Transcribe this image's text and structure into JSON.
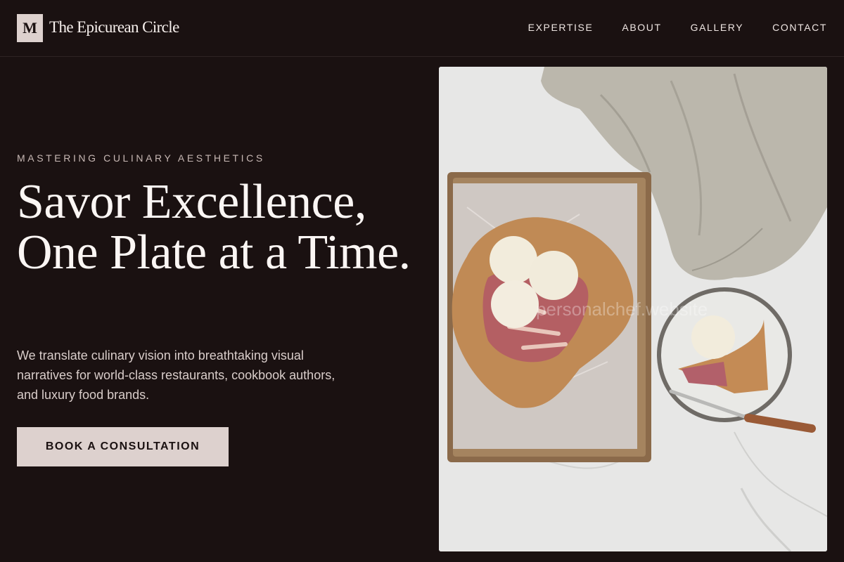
{
  "brand": {
    "mark": "M",
    "name": "The Epicurean Circle"
  },
  "nav": {
    "items": [
      "EXPERTISE",
      "ABOUT",
      "GALLERY",
      "CONTACT"
    ]
  },
  "hero": {
    "eyebrow": "MASTERING CULINARY AESTHETICS",
    "headline": "Savor Excellence, One Plate at a Time.",
    "lede": "We translate culinary vision into breathtaking visual narratives for world-class restaurants, cookbook authors, and luxury food brands.",
    "cta_label": "BOOK A CONSULTATION",
    "image_watermark": "personalchef.website"
  },
  "colors": {
    "background": "#1a1111",
    "accent": "#ddd1ce",
    "text": "#f3ecea"
  }
}
